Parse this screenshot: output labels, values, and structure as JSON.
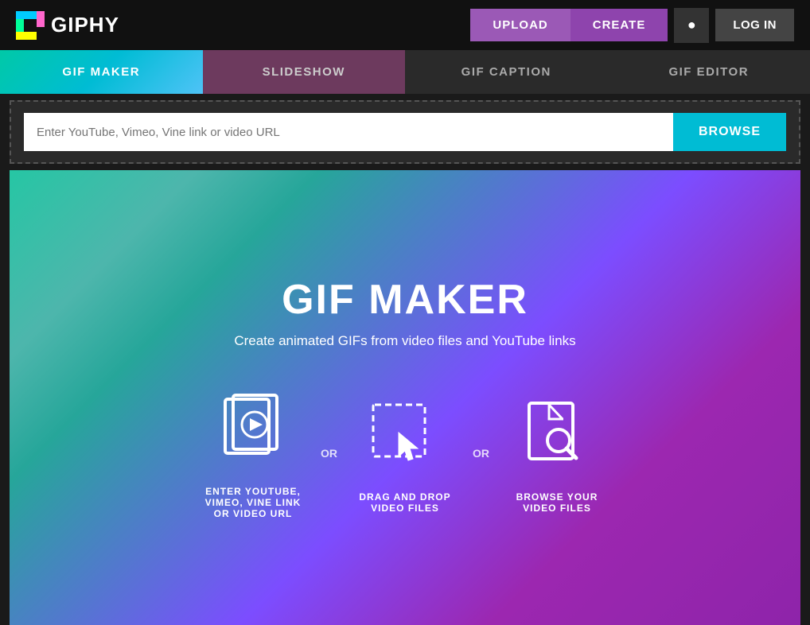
{
  "header": {
    "logo_text": "GIPHY",
    "upload_label": "UPLOAD",
    "create_label": "CREATE",
    "login_label": "LOG IN"
  },
  "tabs": [
    {
      "id": "gif-maker",
      "label": "GIF MAKER",
      "active": true
    },
    {
      "id": "slideshow",
      "label": "SLIDESHOW",
      "active": false
    },
    {
      "id": "gif-caption",
      "label": "GIF CAPTION",
      "active": false
    },
    {
      "id": "gif-editor",
      "label": "GIF EDITOR",
      "active": false
    }
  ],
  "input": {
    "placeholder": "Enter YouTube, Vimeo, Vine link or video URL",
    "browse_label": "BROWSE"
  },
  "main": {
    "title": "GIF MAKER",
    "subtitle": "Create animated GIFs from video files and YouTube links",
    "steps": [
      {
        "id": "enter-url",
        "label": "ENTER YOUTUBE, VIMEO, VINE LINK OR VIDEO URL"
      },
      {
        "id": "drag-drop",
        "label": "DRAG AND DROP VIDEO FILES"
      },
      {
        "id": "browse-files",
        "label": "BROWSE YOUR VIDEO FILES"
      }
    ],
    "or_label": "OR"
  }
}
